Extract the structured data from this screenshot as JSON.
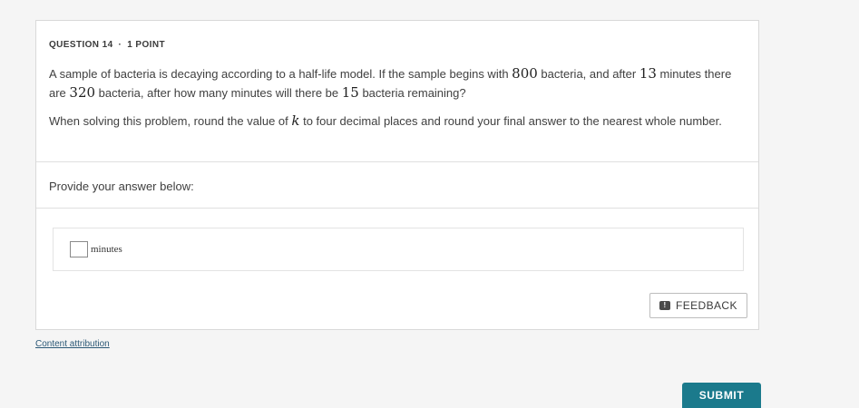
{
  "question": {
    "number_label": "QUESTION 14",
    "separator": "·",
    "points_label": "1 POINT",
    "text_part1": "A sample of bacteria is decaying according to a half-life model. If the sample begins with ",
    "initial_amount": "800",
    "text_part2": " bacteria, and after ",
    "elapsed_time": "13",
    "text_part3": " minutes there are ",
    "later_amount": "320",
    "text_part4": " bacteria, after how many minutes will there be ",
    "target_amount": "15",
    "text_part5": " bacteria remaining?",
    "instruction_part1": "When solving this problem, round the value of ",
    "instruction_var": "k",
    "instruction_part2": " to four decimal places and round your final answer to the nearest whole number."
  },
  "answer_section": {
    "prompt": "Provide your answer below:",
    "input_value": "",
    "unit_label": "minutes"
  },
  "buttons": {
    "feedback_label": "FEEDBACK",
    "feedback_icon_glyph": "!",
    "submit_label": "SUBMIT"
  },
  "footer": {
    "attribution_link": "Content attribution"
  },
  "colors": {
    "submit_bg": "#1b7a8c",
    "link": "#2b5876"
  }
}
